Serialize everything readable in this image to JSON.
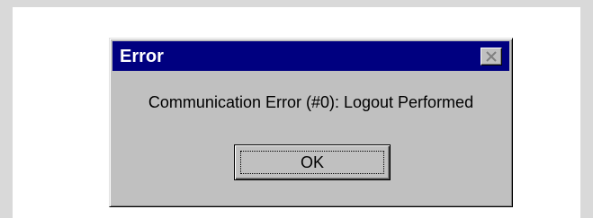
{
  "dialog": {
    "title": "Error",
    "message": "Communication Error (#0): Logout Performed",
    "ok_label": "OK",
    "close_icon": "close-x-icon"
  },
  "colors": {
    "titlebar": "#000080",
    "dialog_face": "#c0c0c0",
    "frame_border": "#d9d9d9"
  }
}
